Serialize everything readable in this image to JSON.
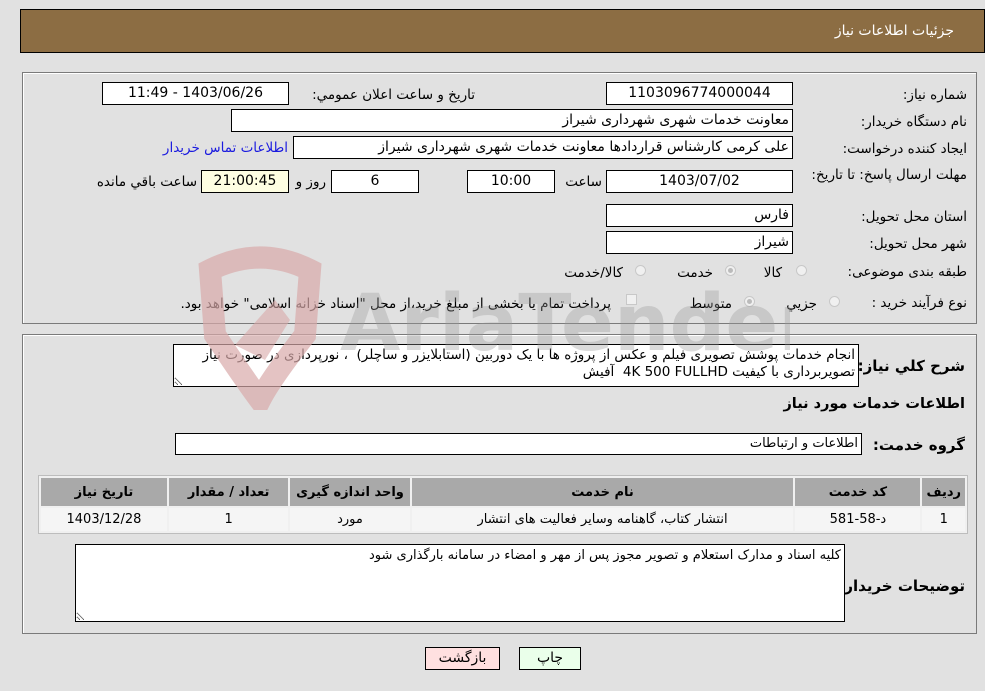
{
  "header": {
    "title": "جزئیات اطلاعات نیاز"
  },
  "details": {
    "need_number": {
      "label": "شماره نیاز:",
      "value": "1103096774000044"
    },
    "announce_datetime": {
      "label": "تاریخ و ساعت اعلان عمومي:",
      "value": "1403/06/26 - 11:49"
    },
    "buyer_org": {
      "label": "نام دستگاه خریدار:",
      "value": "معاونت خدمات شهری شهرداری شیراز"
    },
    "requester": {
      "label": "ایجاد کننده درخواست:",
      "value": "علی کرمی کارشناس قراردادها معاونت خدمات شهری شهرداری شیراز"
    },
    "buyer_contact_link": "اطلاعات تماس خریدار",
    "deadline": {
      "label": "مهلت ارسال پاسخ: تا تاریخ:",
      "date": "1403/07/02",
      "time_label": "ساعت",
      "time": "10:00",
      "days": "6",
      "days_label": "روز و",
      "remaining": "21:00:45",
      "remaining_label": "ساعت باقي مانده"
    },
    "province": {
      "label": "استان محل تحویل:",
      "value": "فارس"
    },
    "city": {
      "label": "شهر محل تحویل:",
      "value": "شیراز"
    },
    "category": {
      "label": "طبقه بندی موضوعی:",
      "options": [
        "کالا",
        "خدمت",
        "کالا/خدمت"
      ],
      "selected": "خدمت"
    },
    "purchase_type": {
      "label": "نوع فرآیند خرید :",
      "options": [
        "جزيي",
        "متوسط"
      ],
      "selected": "متوسط",
      "treasury_note": "پرداخت تمام یا بخشی از مبلغ خرید،از محل \"اسناد خزانه اسلامی\" خواهد بود."
    }
  },
  "description": {
    "label": "شرح کلي نیاز:",
    "value": "انجام خدمات پوشش تصویری فیلم و عکس از پروژه ها با یک دوربین (استابلایزر و ساچلر)  ، نورپردازی در صورت نیاز تصویربرداری با کیفیت 4K 500 FULLHD  آفیش"
  },
  "services": {
    "section_title": "اطلاعات خدمات مورد نیاز",
    "group_label": "گروه خدمت:",
    "group_value": "اطلاعات و ارتباطات",
    "columns": [
      "ردیف",
      "کد خدمت",
      "نام خدمت",
      "واحد اندازه گیری",
      "تعداد / مقدار",
      "تاریخ نیاز"
    ],
    "rows": [
      [
        "1",
        "د-58-581",
        "انتشار کتاب، گاهنامه وسایر فعالیت های انتشار",
        "مورد",
        "1",
        "1403/12/28"
      ]
    ]
  },
  "buyer_notes": {
    "label": "توضیحات خریدار:",
    "value": "کلیه اسناد و مدارک استعلام و تصویر مجوز پس از مهر و امضاء در سامانه بارگذاری شود"
  },
  "buttons": {
    "print": "چاپ",
    "back": "بازگشت"
  },
  "watermark": {
    "text": "AriaTender.neT"
  },
  "colors": {
    "header_bg": "#8c6d43",
    "print_bg": "#eaffea",
    "back_bg": "#ffe0e0",
    "link": "#1a1adf"
  }
}
